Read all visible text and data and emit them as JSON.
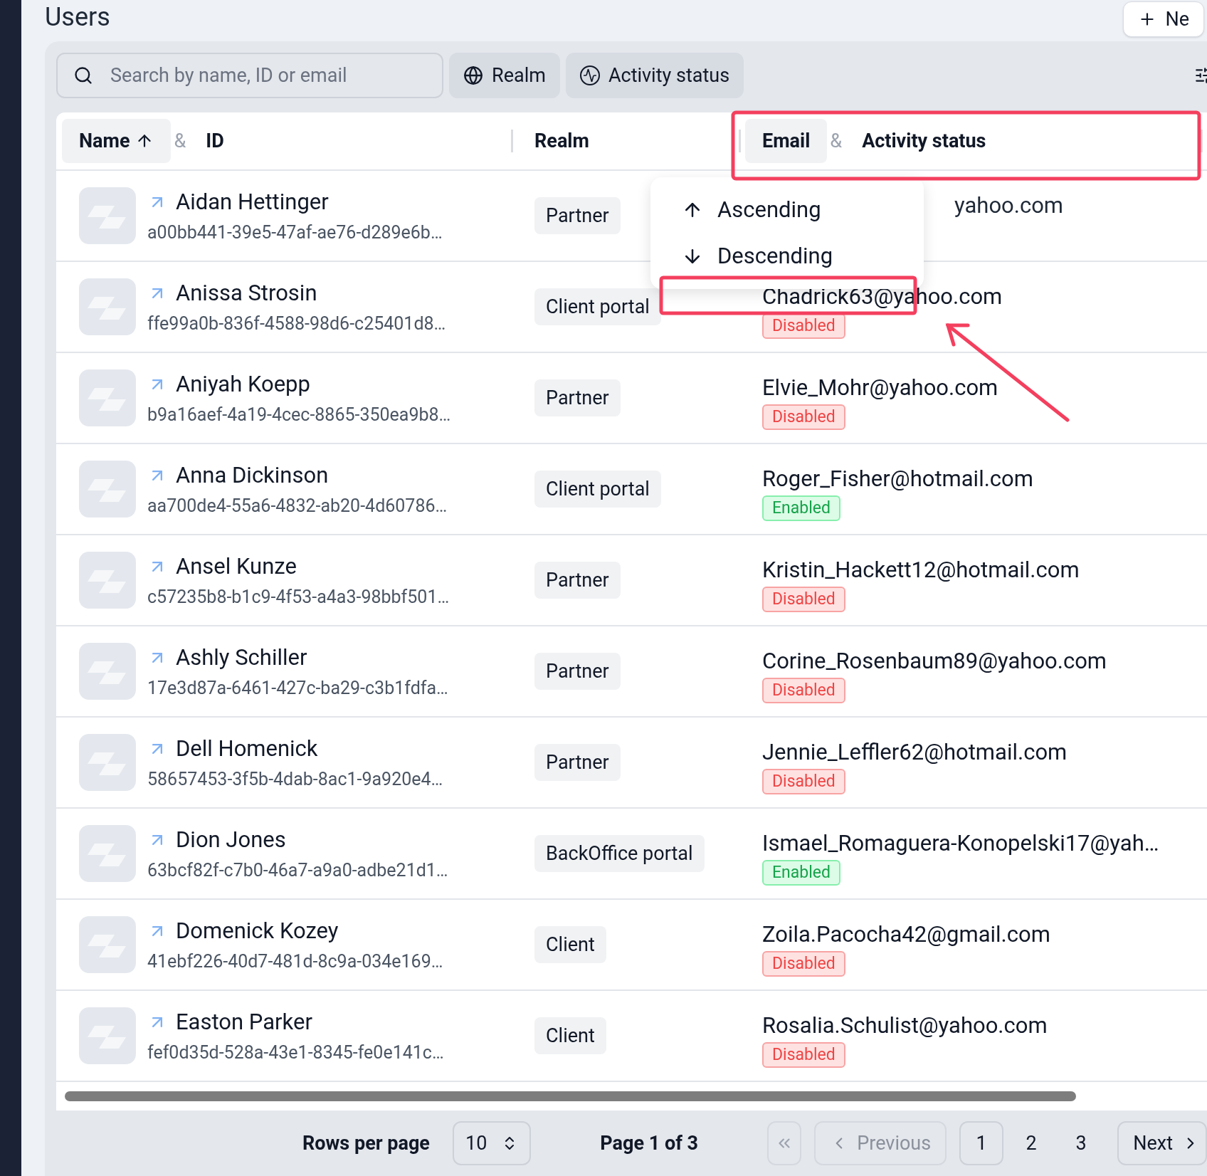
{
  "page": {
    "title": "Users",
    "new_button": "Ne"
  },
  "toolbar": {
    "search": {
      "placeholder": "Search by name, ID or email"
    },
    "filters": [
      {
        "label": "Realm",
        "kind": "globe"
      },
      {
        "label": "Activity status",
        "kind": "activity"
      }
    ]
  },
  "table": {
    "header_groups": [
      {
        "joiner": "&",
        "parts": [
          {
            "label": "Name",
            "highlighted": true,
            "sorted": true
          },
          {
            "label": "ID",
            "highlighted": false,
            "sorted": false
          }
        ]
      },
      {
        "parts": [
          {
            "label": "Realm",
            "highlighted": false,
            "sorted": false
          }
        ]
      },
      {
        "joiner": "&",
        "parts": [
          {
            "label": "Email",
            "highlighted": true,
            "sorted": false
          },
          {
            "label": "Activity status",
            "highlighted": false,
            "sorted": false
          }
        ]
      }
    ],
    "rows": [
      {
        "name": "Aidan Hettinger",
        "id": "a00bb441-39e5-47af-ae76-d289e6b…",
        "realm": "Partner",
        "email": "yahoo.com",
        "covered": true
      },
      {
        "name": "Anissa Strosin",
        "id": "ffe99a0b-836f-4588-98d6-c25401d8…",
        "realm": "Client portal",
        "email": "Chadrick63@yahoo.com",
        "covered": false,
        "status": {
          "label": "Disabled",
          "kind": "disabled"
        }
      },
      {
        "name": "Aniyah Koepp",
        "id": "b9a16aef-4a19-4cec-8865-350ea9b8…",
        "realm": "Partner",
        "email": "Elvie_Mohr@yahoo.com",
        "covered": false,
        "status": {
          "label": "Disabled",
          "kind": "disabled"
        }
      },
      {
        "name": "Anna Dickinson",
        "id": "aa700de4-55a6-4832-ab20-4d60786…",
        "realm": "Client portal",
        "email": "Roger_Fisher@hotmail.com",
        "covered": false,
        "status": {
          "label": "Enabled",
          "kind": "enabled"
        }
      },
      {
        "name": "Ansel Kunze",
        "id": "c57235b8-b1c9-4f53-a4a3-98bbf501…",
        "realm": "Partner",
        "email": "Kristin_Hackett12@hotmail.com",
        "covered": false,
        "status": {
          "label": "Disabled",
          "kind": "disabled"
        }
      },
      {
        "name": "Ashly Schiller",
        "id": "17e3d87a-6461-427c-ba29-c3b1fdfa…",
        "realm": "Partner",
        "email": "Corine_Rosenbaum89@yahoo.com",
        "covered": false,
        "status": {
          "label": "Disabled",
          "kind": "disabled"
        }
      },
      {
        "name": "Dell Homenick",
        "id": "58657453-3f5b-4dab-8ac1-9a920e4…",
        "realm": "Partner",
        "email": "Jennie_Leffler62@hotmail.com",
        "covered": false,
        "status": {
          "label": "Disabled",
          "kind": "disabled"
        }
      },
      {
        "name": "Dion Jones",
        "id": "63bcf82f-c7b0-46a7-a9a0-adbe21d1…",
        "realm": "BackOffice portal",
        "email": "Ismael_Romaguera-Konopelski17@yah…",
        "covered": false,
        "status": {
          "label": "Enabled",
          "kind": "enabled"
        }
      },
      {
        "name": "Domenick Kozey",
        "id": "41ebf226-40d7-481d-8c9a-034e169…",
        "realm": "Client",
        "email": "Zoila.Pacocha42@gmail.com",
        "covered": false,
        "status": {
          "label": "Disabled",
          "kind": "disabled"
        }
      },
      {
        "name": "Easton Parker",
        "id": "fef0d35d-528a-43e1-8345-fe0e141c…",
        "realm": "Client",
        "email": "Rosalia.Schulist@yahoo.com",
        "covered": false,
        "status": {
          "label": "Disabled",
          "kind": "disabled"
        }
      }
    ]
  },
  "sort_menu": {
    "items": [
      {
        "label": "Ascending",
        "kind": "up"
      },
      {
        "label": "Descending",
        "kind": "down"
      }
    ]
  },
  "pagination": {
    "rows_label": "Rows per page",
    "rows_value": "10",
    "page_label": "Page 1 of 3",
    "previous": {
      "label": "Previous",
      "disabled": true
    },
    "pages": [
      {
        "label": "1",
        "selected": true
      },
      {
        "label": "2",
        "selected": false
      },
      {
        "label": "3",
        "selected": false
      }
    ],
    "next": {
      "label": "Next",
      "disabled": false
    }
  }
}
